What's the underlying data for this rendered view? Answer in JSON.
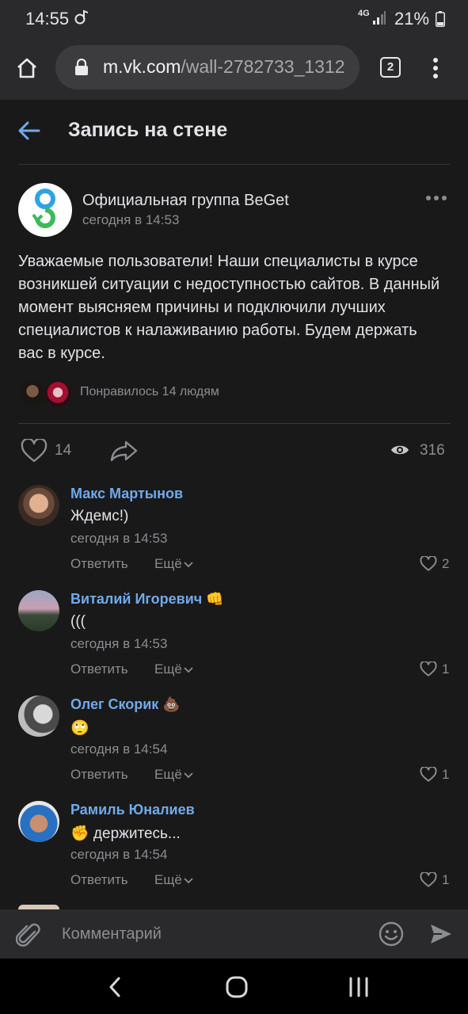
{
  "status_bar": {
    "time": "14:55",
    "network": "4G",
    "battery": "21%"
  },
  "browser": {
    "url_host": "m.vk.com",
    "url_path": "/wall-2782733_1312",
    "tab_count": "2"
  },
  "page": {
    "title": "Запись на стене"
  },
  "post": {
    "author": "Официальная группа BeGet",
    "time": "сегодня в 14:53",
    "text": "Уважаемые пользователи! Наши специалисты в курсе возникшей ситуации с недоступностью сайтов. В данный момент выясняем причины и подключили лучших специалистов к налаживанию работы. Будем держать вас в курсе.",
    "liked_by": "Понравилось 14 людям",
    "likes": "14",
    "views": "316"
  },
  "comments": [
    {
      "name": "Макс Мартынов",
      "emoji": "",
      "text": "Ждемс!)",
      "time": "сегодня в 14:53",
      "reply": "Ответить",
      "more": "Ещё",
      "likes": "2"
    },
    {
      "name": "Виталий Игоревич",
      "emoji": "👊",
      "text": "(((",
      "time": "сегодня в 14:53",
      "reply": "Ответить",
      "more": "Ещё",
      "likes": "1"
    },
    {
      "name": "Олег Скорик",
      "emoji": "💩",
      "text": "🙄",
      "time": "сегодня в 14:54",
      "reply": "Ответить",
      "more": "Ещё",
      "likes": "1"
    },
    {
      "name": "Рамиль Юналиев",
      "emoji": "",
      "text": "✊ держитесь...",
      "time": "сегодня в 14:54",
      "reply": "Ответить",
      "more": "Ещё",
      "likes": "1"
    }
  ],
  "input": {
    "placeholder": "Комментарий"
  },
  "colors": {
    "accent": "#71aaeb",
    "background": "#19191a",
    "bar": "#2a2a2c",
    "muted": "#8b8d90"
  }
}
